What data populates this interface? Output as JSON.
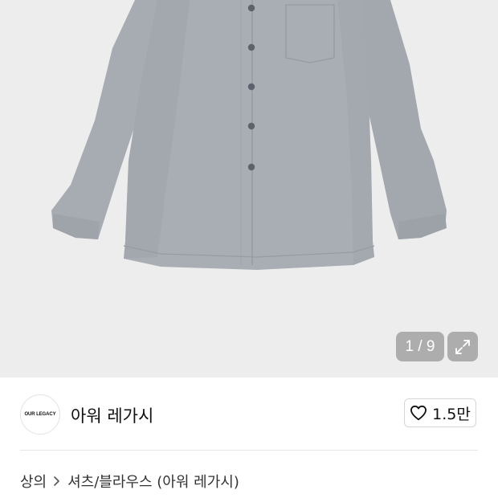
{
  "gallery": {
    "image_description": "gray long-sleeve button-up shirt",
    "counter": "1 / 9",
    "icons": {
      "expand": "expand-icon"
    }
  },
  "brand": {
    "logo_text": "OUR LEGACY",
    "name": "아워 레가시",
    "like_count": "1.5만",
    "icons": {
      "like": "heart-outline-icon"
    }
  },
  "breadcrumb": {
    "items": [
      "상의",
      "셔츠/블라우스 (아워 레가시)"
    ],
    "icons": {
      "separator": "chevron-right-icon"
    }
  },
  "colors": {
    "gallery_bg": "#ededed",
    "shirt": "#a5a9b0",
    "badge_bg": "#8a8a8a"
  }
}
